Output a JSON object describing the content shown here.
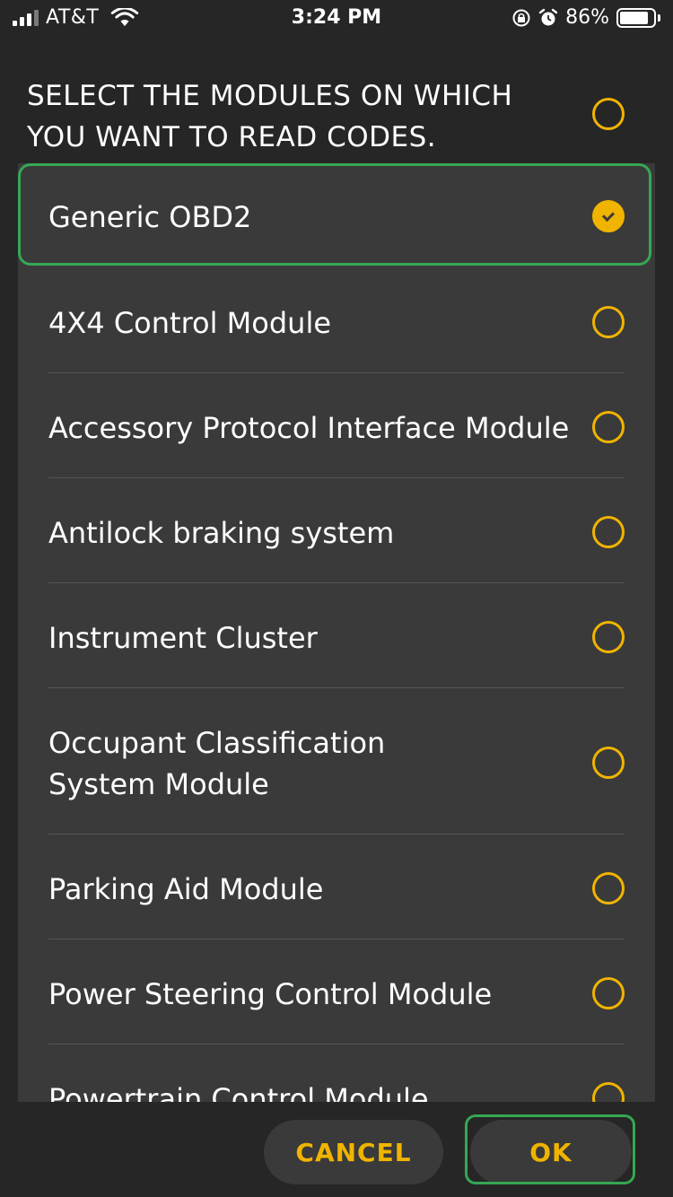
{
  "status_bar": {
    "carrier": "AT&T",
    "time": "3:24 PM",
    "battery_percent": "86%",
    "battery_level": 0.86,
    "icons": [
      "signal-icon",
      "wifi-icon",
      "orientation-lock-icon",
      "alarm-icon",
      "battery-icon"
    ]
  },
  "heading": {
    "line1": "SELECT THE MODULES ON WHICH",
    "line2": "YOU WANT TO READ CODES."
  },
  "modules": [
    {
      "label": "Generic OBD2",
      "selected": true
    },
    {
      "label": "4X4 Control Module",
      "selected": false
    },
    {
      "label": "Accessory Protocol Interface Module",
      "selected": false
    },
    {
      "label": "Antilock braking system",
      "selected": false
    },
    {
      "label": "Instrument Cluster",
      "selected": false
    },
    {
      "label_line1": "Occupant Classification",
      "label_line2": "System Module",
      "selected": false
    },
    {
      "label": "Parking Aid Module",
      "selected": false
    },
    {
      "label": "Power Steering Control Module",
      "selected": false
    },
    {
      "label": "Powertrain Control Module",
      "selected": false
    }
  ],
  "buttons": {
    "cancel": "CANCEL",
    "ok": "OK"
  },
  "colors": {
    "accent": "#f0b400",
    "highlight": "#35a853",
    "panel": "#3a3a3a",
    "background": "#262626"
  }
}
